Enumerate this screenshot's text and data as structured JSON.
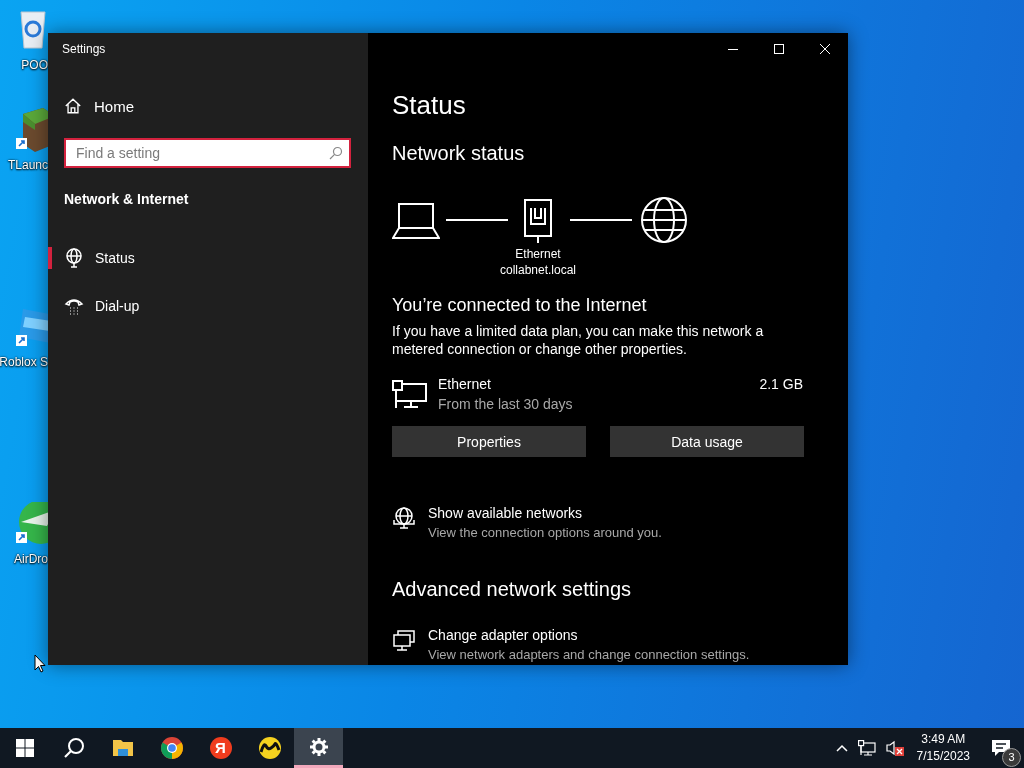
{
  "desktop": {
    "icons": [
      {
        "kind": "recycle",
        "label": "POO"
      },
      {
        "kind": "grass",
        "label": "TLaunc"
      },
      {
        "kind": "roblox",
        "label": "Roblox S"
      },
      {
        "kind": "airdroid",
        "label": "AirDro"
      }
    ]
  },
  "window": {
    "title": "Settings"
  },
  "sidebar": {
    "home": "Home",
    "search": {
      "placeholder": "Find a setting"
    },
    "section_title": "Network & Internet",
    "items": [
      {
        "kind": "status",
        "label": "Status",
        "selected": true
      },
      {
        "kind": "dialup",
        "label": "Dial-up",
        "selected": false
      }
    ]
  },
  "content": {
    "title": "Status",
    "network_status": {
      "heading": "Network status",
      "adapter": "Ethernet",
      "network": "collabnet.local"
    },
    "connection": {
      "heading": "You’re connected to the Internet",
      "text": "If you have a limited data plan, you can make this network a metered connection or change other properties."
    },
    "usage": {
      "name": "Ethernet",
      "period": "From the last 30 days",
      "amount": "2.1 GB"
    },
    "buttons": [
      "Properties",
      "Data usage"
    ],
    "links": [
      {
        "kind": "networks",
        "title": "Show available networks",
        "subtitle": "View the connection options around you."
      }
    ],
    "advanced": {
      "heading": "Advanced network settings",
      "links": [
        {
          "kind": "adapters",
          "title": "Change adapter options",
          "subtitle": "View network adapters and change connection settings."
        }
      ]
    }
  },
  "taskbar": {
    "apps": [
      {
        "kind": "start",
        "selected": false
      },
      {
        "kind": "search",
        "selected": false
      },
      {
        "kind": "explorer",
        "selected": false
      },
      {
        "kind": "chrome",
        "selected": false
      },
      {
        "kind": "yandex",
        "glyph": "Я",
        "selected": false
      },
      {
        "kind": "market",
        "selected": false
      },
      {
        "kind": "settings",
        "selected": true
      }
    ],
    "tray": {
      "time": "3:49 AM",
      "date": "7/15/2023",
      "notification_count": "3"
    }
  }
}
